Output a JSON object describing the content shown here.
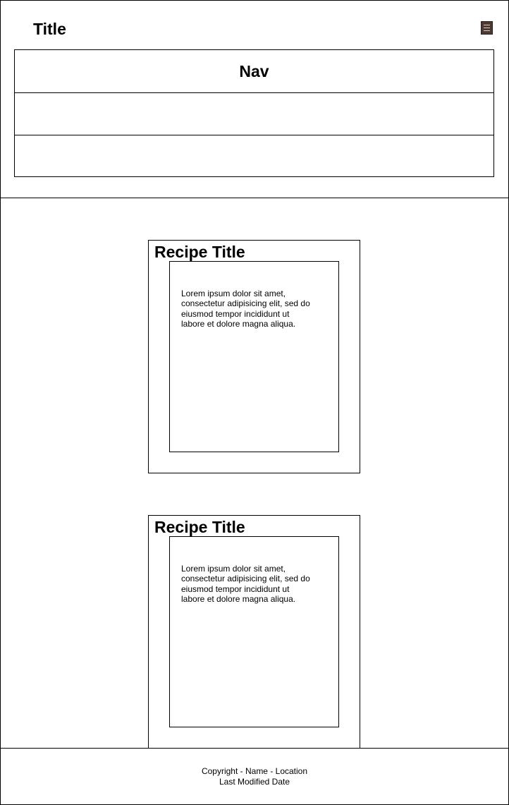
{
  "header": {
    "title": "Title",
    "menu_icon": "hamburger-menu-icon",
    "nav": {
      "label": "Nav",
      "rows": [
        "Nav",
        "",
        ""
      ]
    }
  },
  "recipes": [
    {
      "title": "Recipe Title",
      "text": "Lorem ipsum dolor sit amet, consectetur adipisicing elit, sed do eiusmod tempor incididunt ut labore et dolore magna aliqua."
    },
    {
      "title": "Recipe Title",
      "text": "Lorem ipsum dolor sit amet, consectetur adipisicing elit, sed do eiusmod tempor incididunt ut labore et dolore magna aliqua."
    }
  ],
  "footer": {
    "line1": "Copyright - Name - Location",
    "line2": "Last Modified Date"
  }
}
